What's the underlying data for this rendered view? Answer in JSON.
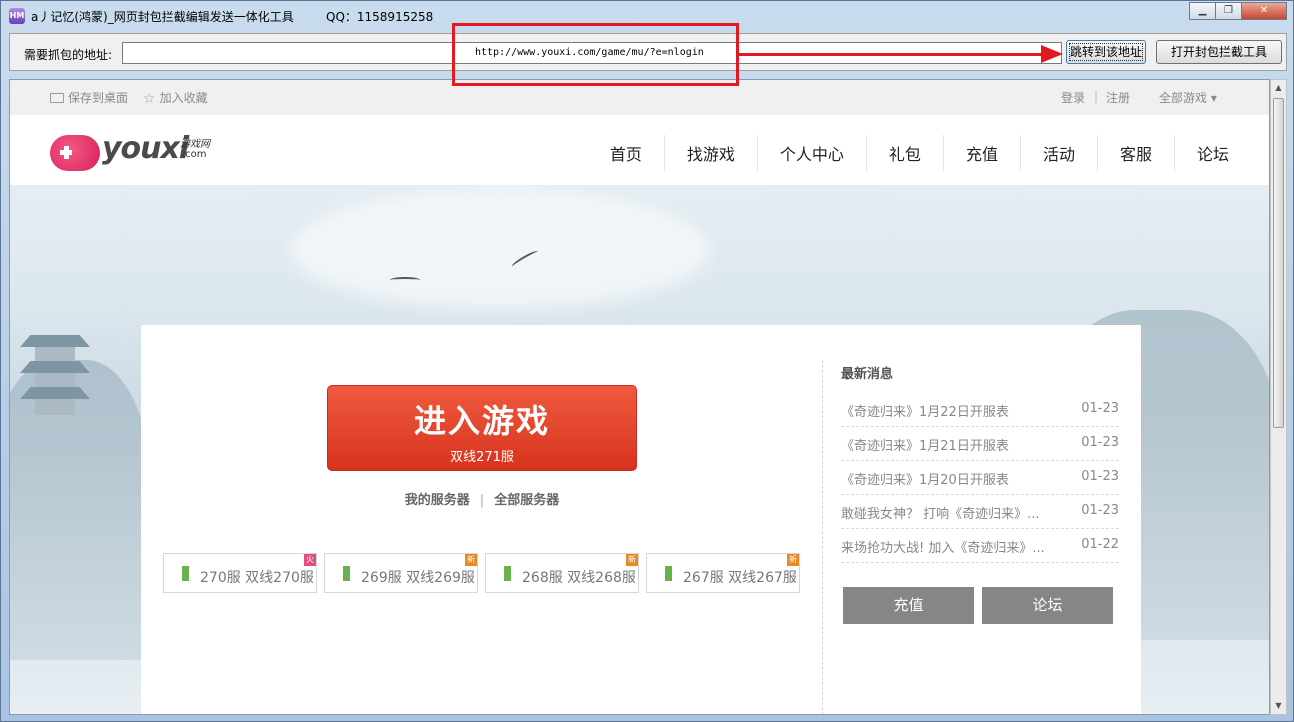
{
  "window": {
    "title": "a丿记忆(鸿蒙)_网页封包拦截编辑发送一体化工具",
    "qq": "QQ：1158915258",
    "icon_text": "HM",
    "min_label": "▁",
    "max_label": "❐",
    "close_label": "✕"
  },
  "toolbar": {
    "url_label": "需要抓包的地址:",
    "url_value": "http://www.youxi.com/game/mu/?e=nlogin",
    "jump_label": "跳转到该地址",
    "open_label": "打开封包拦截工具"
  },
  "site": {
    "topbar": {
      "save_desktop": "保存到桌面",
      "add_favorite": "加入收藏",
      "login": "登录",
      "divider": "|",
      "register": "注册",
      "all_games": "全部游戏 ▾"
    },
    "logo": {
      "word": "youxi",
      "sub": "游戏网",
      "com": ".com"
    },
    "nav": [
      "首页",
      "找游戏",
      "个人中心",
      "礼包",
      "充值",
      "活动",
      "客服",
      "论坛"
    ],
    "enter": {
      "title": "进入游戏",
      "sub": "双线271服"
    },
    "server_links": {
      "mine": "我的服务器",
      "sep": "|",
      "all": "全部服务器"
    },
    "servers": [
      {
        "text": "270服 双线270服",
        "badge": "火"
      },
      {
        "text": "269服 双线269服",
        "badge": "新"
      },
      {
        "text": "268服 双线268服",
        "badge": "新"
      },
      {
        "text": "267服 双线267服",
        "badge": "新"
      }
    ],
    "news_title": "最新消息",
    "news": [
      {
        "text": "《奇迹归来》1月22日开服表",
        "date": "01-23"
      },
      {
        "text": "《奇迹归来》1月21日开服表",
        "date": "01-23"
      },
      {
        "text": "《奇迹归来》1月20日开服表",
        "date": "01-23"
      },
      {
        "text": "敢碰我女神？ 打响《奇迹归来》...",
        "date": "01-23"
      },
      {
        "text": "来场抢功大战! 加入《奇迹归来》...",
        "date": "01-22"
      }
    ],
    "buttons": {
      "recharge": "充值",
      "forum": "论坛"
    }
  },
  "colors": {
    "annotation": "#e2191e",
    "enter_button": "#e04128",
    "logo_pink": "#d81e57"
  }
}
